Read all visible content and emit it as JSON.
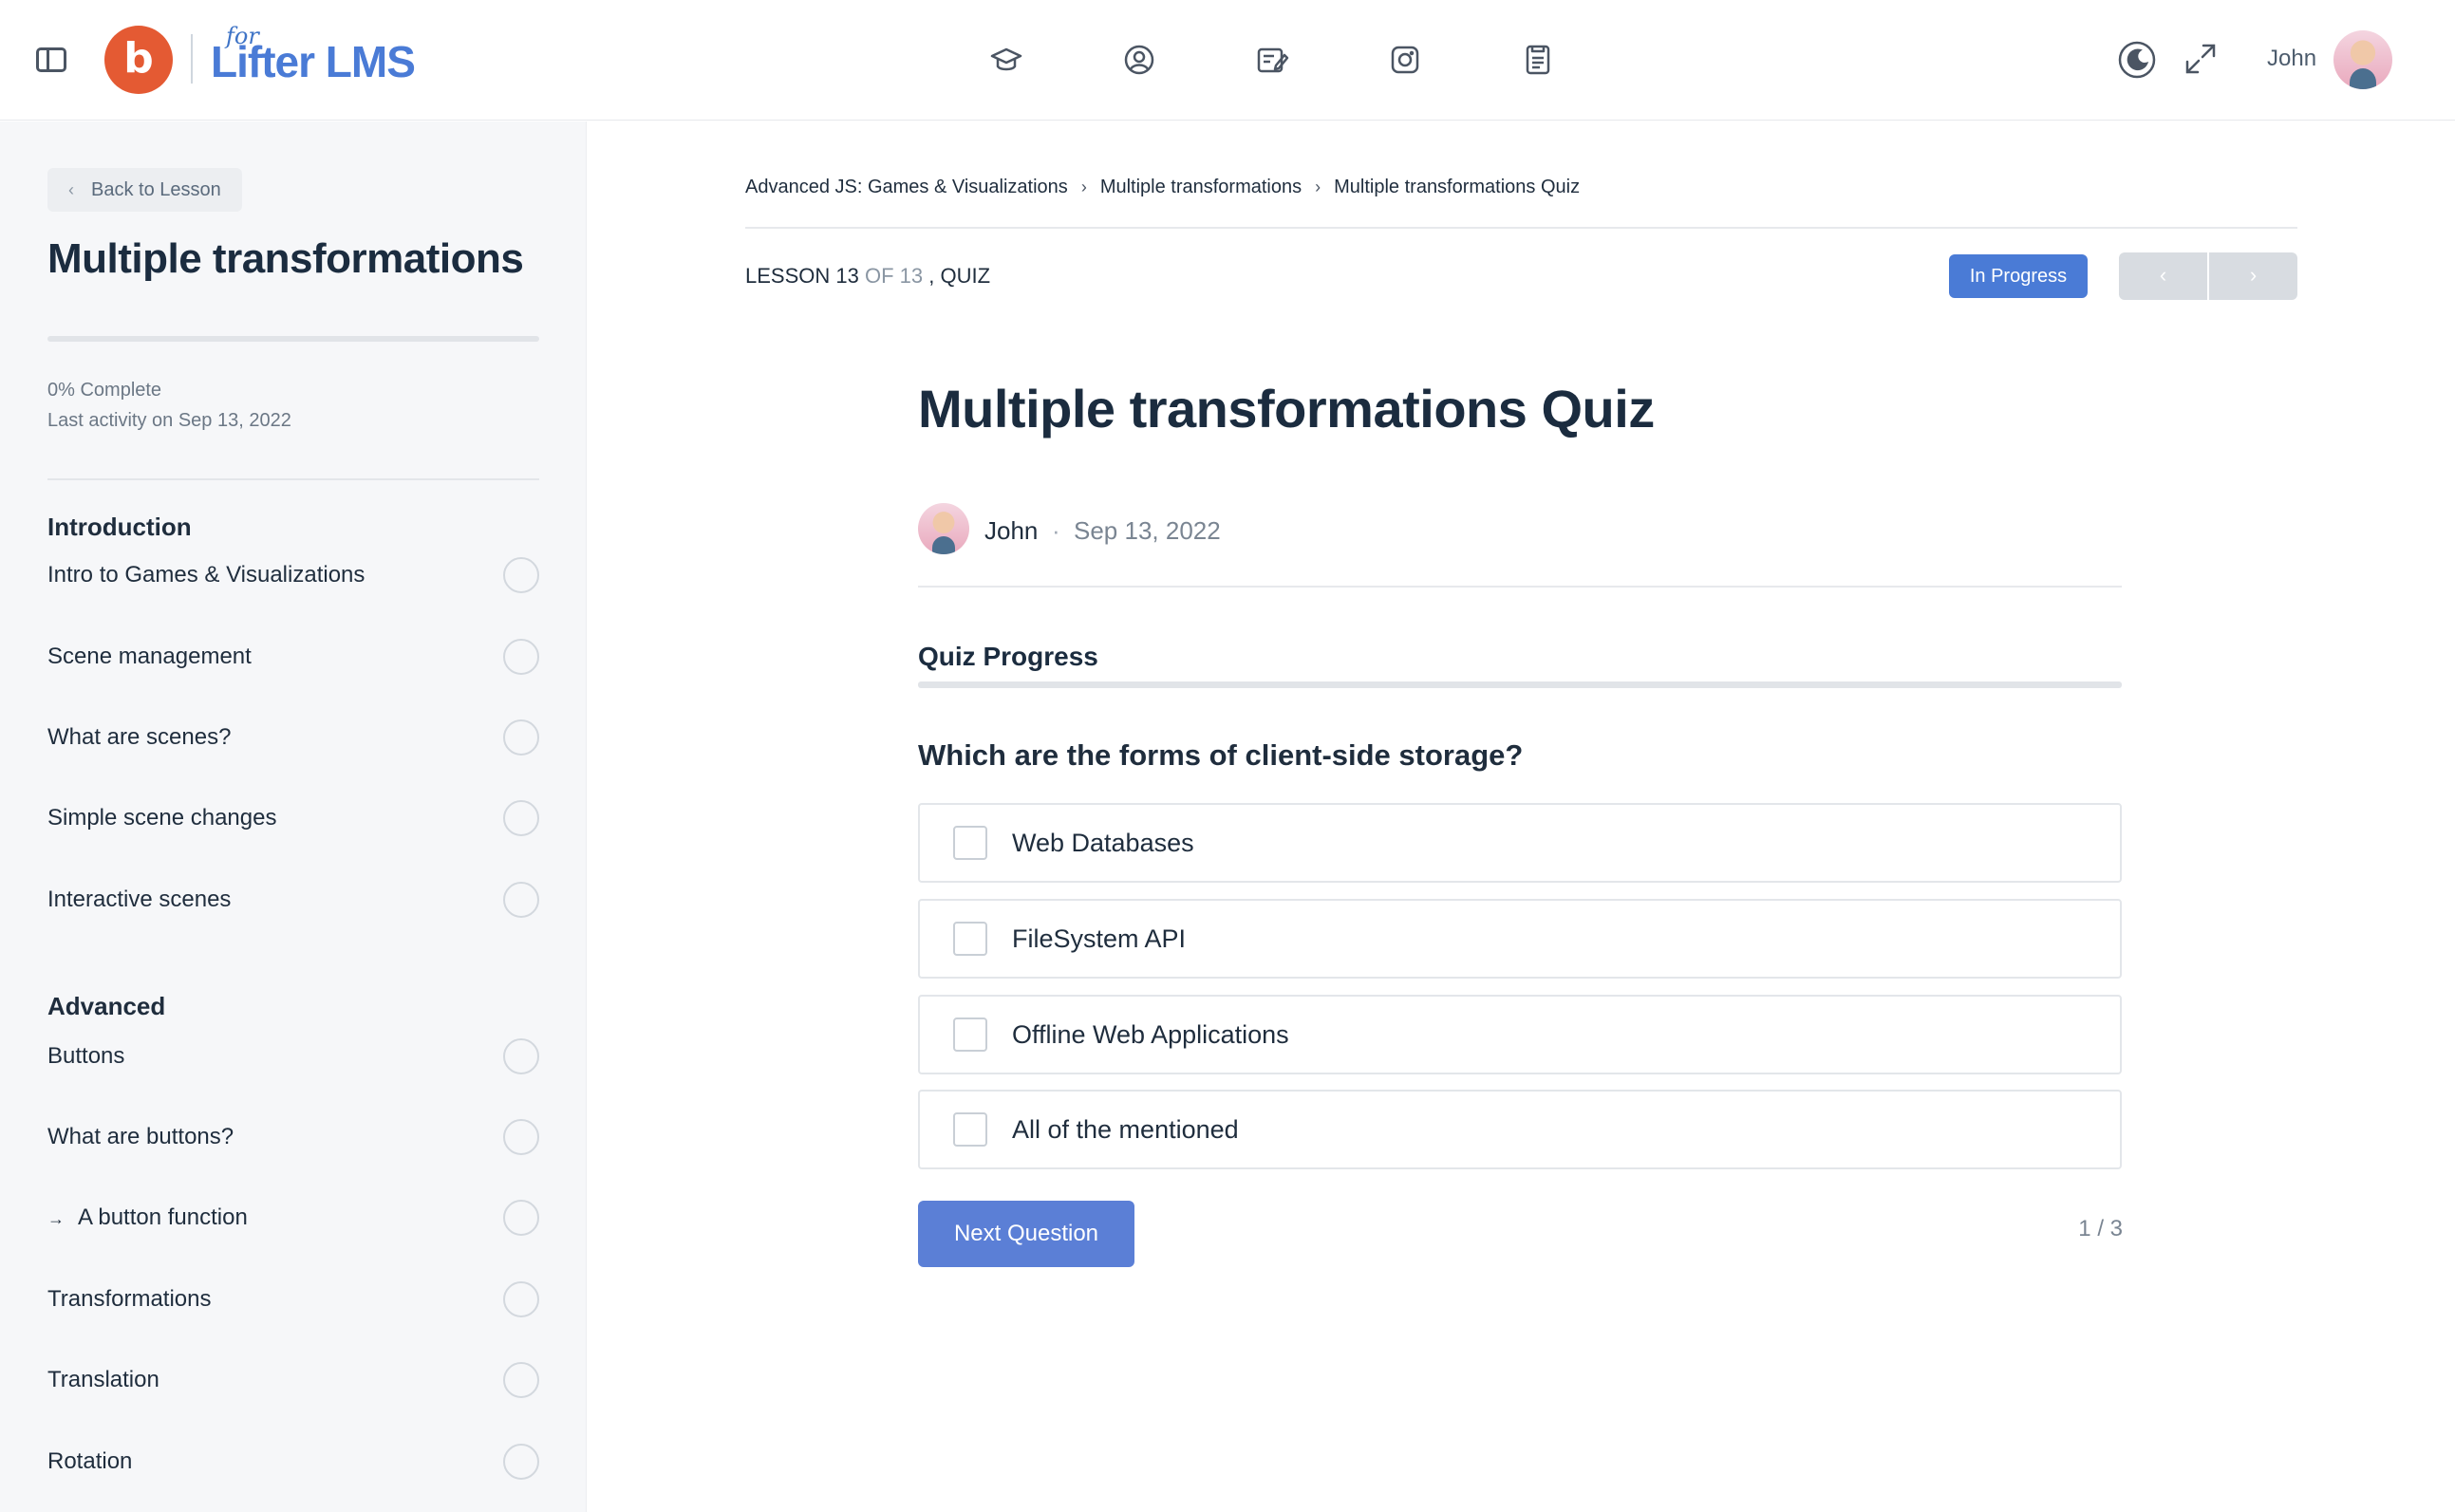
{
  "header": {
    "logo": {
      "initial": "b",
      "for": "for",
      "brand_a": "Lifter",
      "brand_b": "LMS"
    },
    "nav_icons": [
      "courses-icon",
      "profile-icon",
      "notes-icon",
      "camera-icon",
      "document-icon"
    ],
    "user_name": "John"
  },
  "sidebar": {
    "back_label": "Back to Lesson",
    "course_title": "Multiple transformations",
    "progress_percent": 0,
    "complete_label": "0% Complete",
    "last_activity": "Last activity on Sep 13, 2022",
    "sections": [
      {
        "title": "Introduction",
        "lessons": [
          {
            "label": "Intro to Games & Visualizations",
            "current": false
          },
          {
            "label": "Scene management",
            "current": false
          },
          {
            "label": "What are scenes?",
            "current": false
          },
          {
            "label": "Simple scene changes",
            "current": false
          },
          {
            "label": "Interactive scenes",
            "current": false
          }
        ]
      },
      {
        "title": "Advanced",
        "lessons": [
          {
            "label": "Buttons",
            "current": false
          },
          {
            "label": "What are buttons?",
            "current": false
          },
          {
            "label": "A button function",
            "current": true
          },
          {
            "label": "Transformations",
            "current": false
          },
          {
            "label": "Translation",
            "current": false
          },
          {
            "label": "Rotation",
            "current": false
          }
        ]
      }
    ],
    "current_marker": "→"
  },
  "main": {
    "breadcrumb": [
      "Advanced JS: Games & Visualizations",
      "Multiple transformations",
      "Multiple transformations Quiz"
    ],
    "breadcrumb_sep": "›",
    "lesson_counter": {
      "lesson": "LESSON 13",
      "of": "OF 13",
      "type": ", QUIZ"
    },
    "status": "In Progress",
    "nav_prev": "‹",
    "nav_next": "›",
    "quiz_title": "Multiple transformations Quiz",
    "author": "John",
    "author_sep": "·",
    "date": "Sep 13, 2022",
    "quiz_progress_label": "Quiz Progress",
    "quiz_progress_percent": 0,
    "question": "Which are the forms of client-side storage?",
    "options": [
      "Web Databases",
      "FileSystem API",
      "Offline Web Applications",
      "All of the mentioned"
    ],
    "next_button": "Next Question",
    "question_counter": "1 / 3"
  },
  "colors": {
    "accent": "#4a7bd6",
    "brand_orange": "#e45a33",
    "sidebar_bg": "#f6f7f9"
  }
}
